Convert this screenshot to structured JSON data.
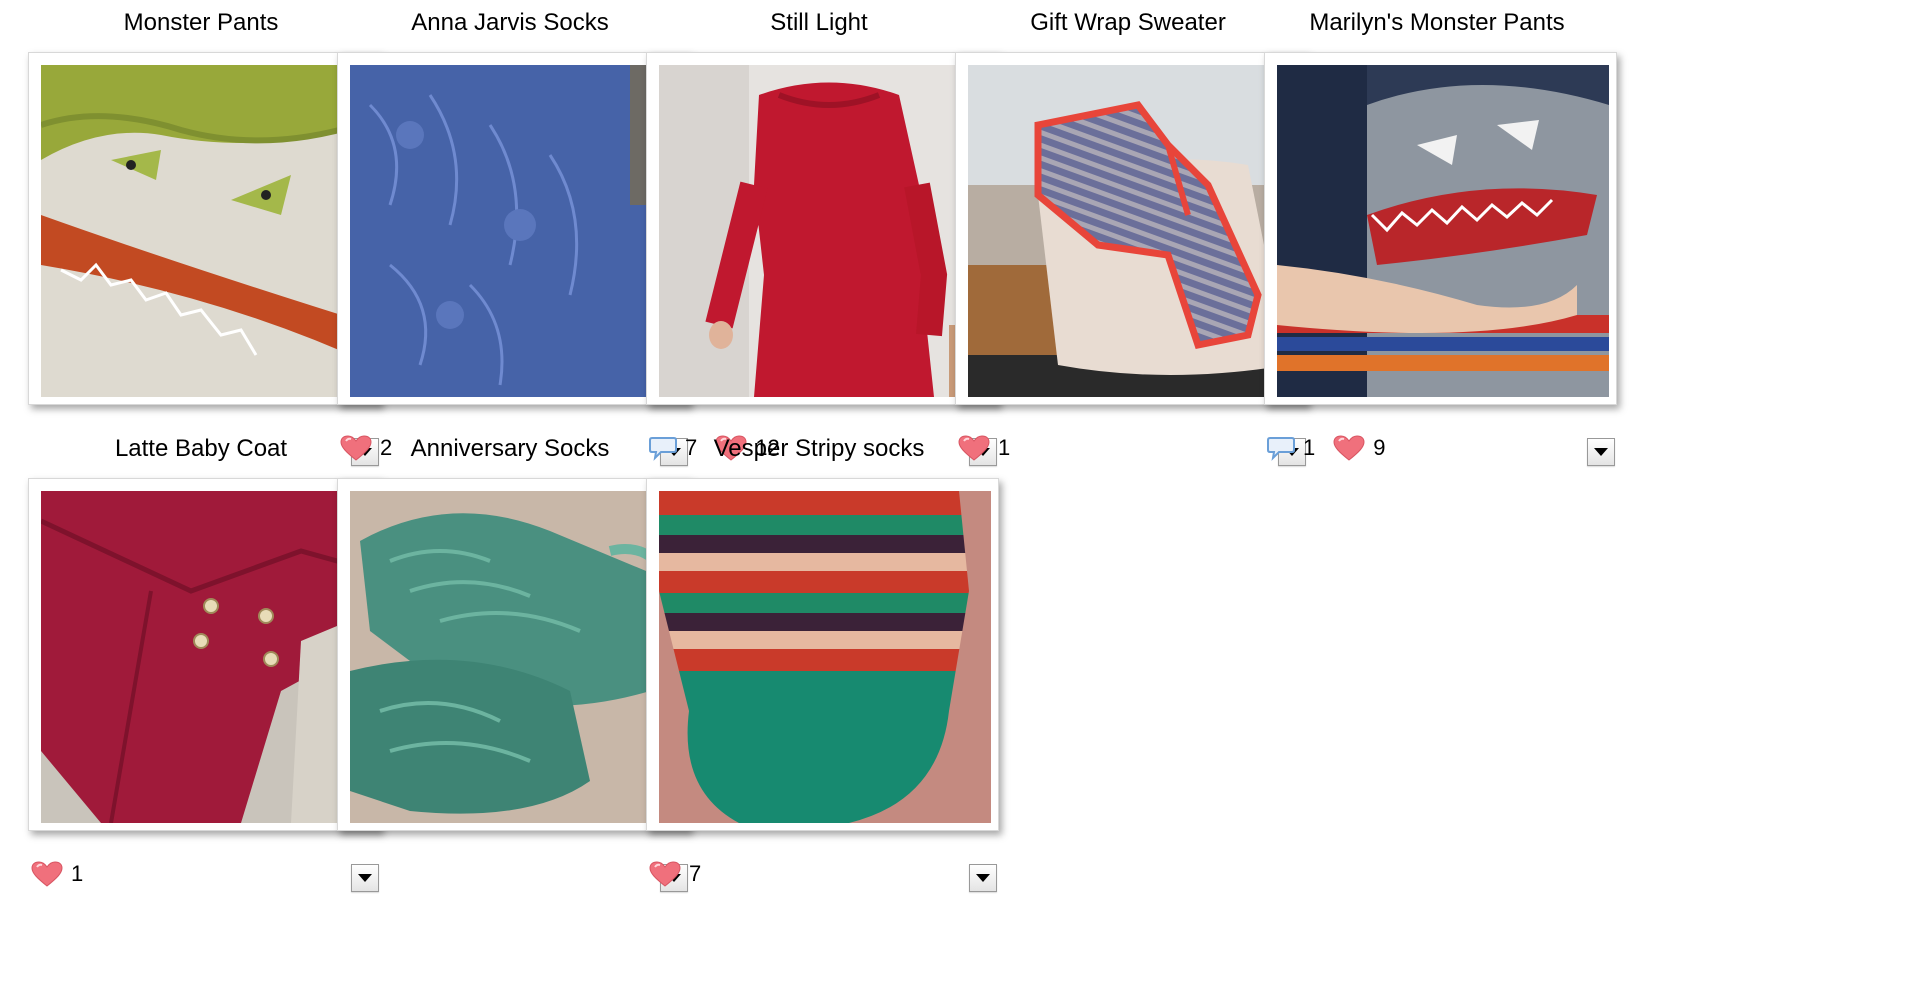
{
  "projects": [
    {
      "title": "Monster Pants",
      "comments": null,
      "hearts": null
    },
    {
      "title": "Anna Jarvis Socks",
      "comments": null,
      "hearts": "2"
    },
    {
      "title": "Still Light",
      "comments": "7",
      "hearts": "12"
    },
    {
      "title": "Gift Wrap Sweater",
      "comments": null,
      "hearts": "1"
    },
    {
      "title": "Marilyn's Monster Pants",
      "comments": "1",
      "hearts": "9"
    },
    {
      "title": "Latte Baby Coat",
      "comments": null,
      "hearts": "1"
    },
    {
      "title": "Anniversary Socks",
      "comments": null,
      "hearts": null
    },
    {
      "title": "Vesper Stripy socks",
      "comments": null,
      "hearts": "7"
    }
  ],
  "icons": {
    "heart": "heart-icon",
    "comment": "comment-bubble-icon",
    "menu": "chevron-down-icon"
  },
  "colors": {
    "heart": "#f0707c",
    "comment": "#6a9fd8"
  }
}
